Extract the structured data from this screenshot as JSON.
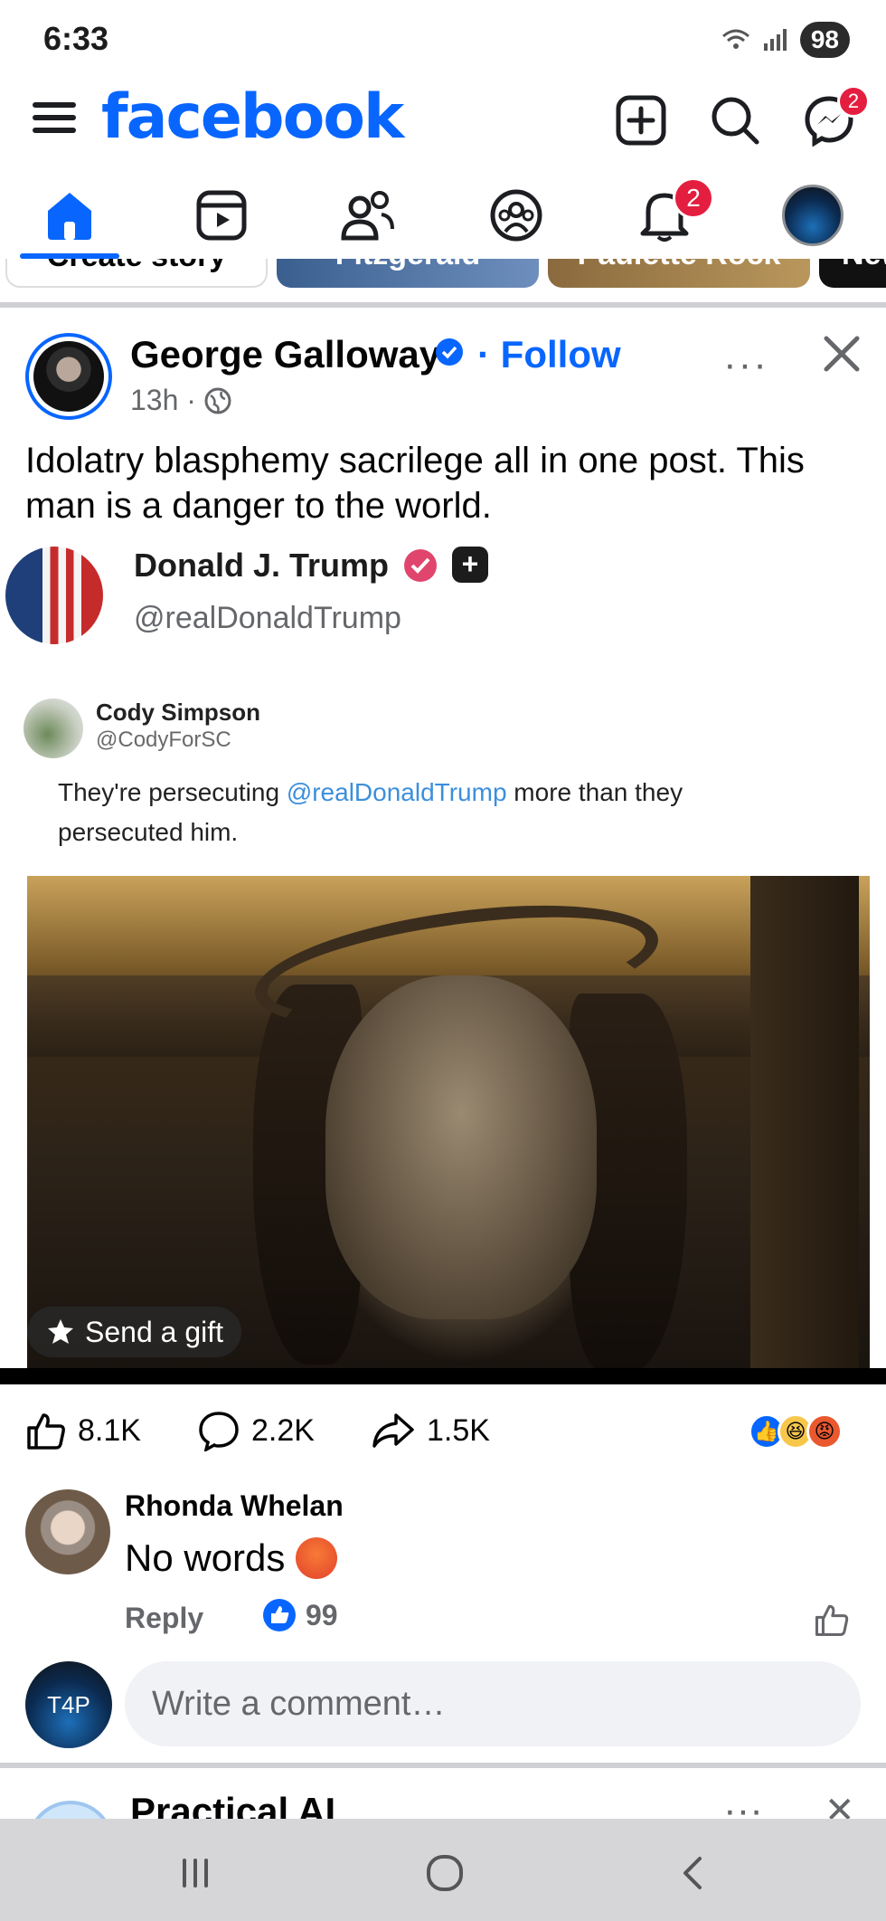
{
  "status": {
    "time": "6:33",
    "battery": "98"
  },
  "header": {
    "logo": "facebook",
    "messenger_badge": "2",
    "notifications_badge": "2"
  },
  "stories": {
    "create": "Create story",
    "story_2": "Fitzgerald",
    "story_3": "Paulette Rock",
    "story_4": "New"
  },
  "post": {
    "author": "George Galloway",
    "follow": "Follow",
    "separator": "·",
    "time": "13h ·",
    "text": "Idolatry blasphemy sacrilege all in one post. This man is a danger to the world.",
    "embed": {
      "name": "Donald J. Trump",
      "handle": "@realDonaldTrump",
      "quoted_name": "Cody Simpson",
      "quoted_handle": "@CodyForSC",
      "quoted_text_before": "They're persecuting ",
      "quoted_mention": "@realDonaldTrump",
      "quoted_text_after": " more than they persecuted him."
    },
    "send_gift": "Send a gift",
    "likes": "8.1K",
    "comments": "2.2K",
    "shares": "1.5K"
  },
  "comment": {
    "author": "Rhonda Whelan",
    "text": "No words",
    "reply_label": "Reply",
    "likes": "99"
  },
  "composer": {
    "placeholder": "Write a comment…",
    "avatar_text": "T4P"
  },
  "next_post": {
    "author": "Practical AI",
    "more": "···",
    "close": "✕"
  },
  "colors": {
    "brand": "#0866ff",
    "badge": "#e41e3f"
  },
  "icons": [
    "menu-icon",
    "plus-square-icon",
    "search-icon",
    "messenger-icon",
    "home-icon",
    "video-icon",
    "friends-icon",
    "groups-icon",
    "bell-icon",
    "verified-icon",
    "globe-icon",
    "more-icon",
    "close-icon",
    "like-icon",
    "comment-icon",
    "share-icon",
    "gift-icon"
  ]
}
